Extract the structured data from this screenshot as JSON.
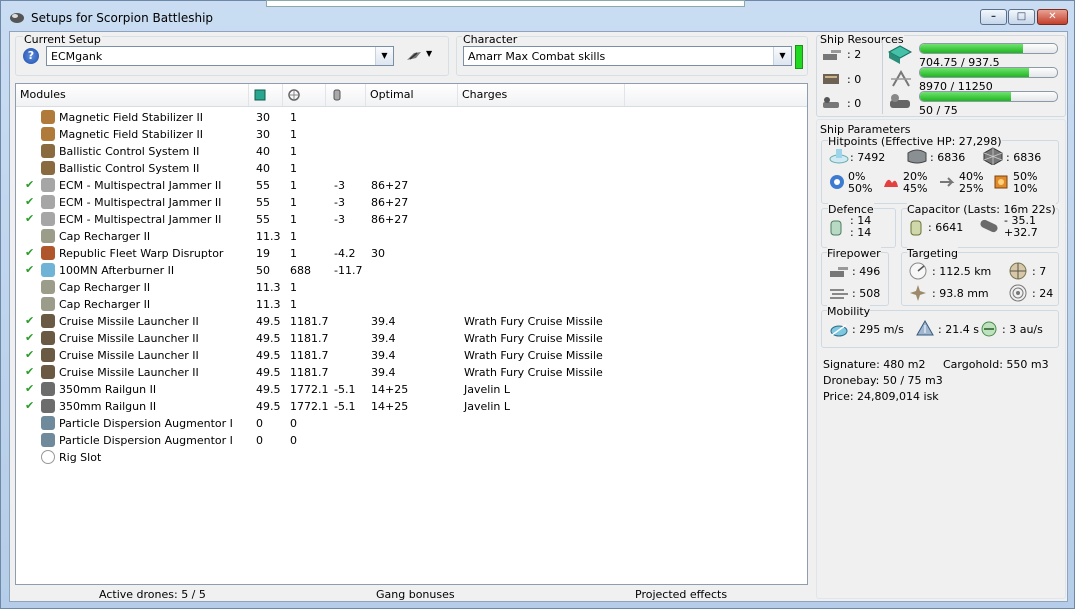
{
  "window": {
    "title": "Setups for Scorpion Battleship",
    "minimize_glyph": "–",
    "maximize_glyph": "□",
    "close_glyph": "✕"
  },
  "setup": {
    "label": "Current Setup",
    "value": "ECMgank"
  },
  "character": {
    "label": "Character",
    "value": "Amarr Max Combat skills"
  },
  "grid": {
    "columns": [
      "Modules",
      "",
      "",
      "",
      "Optimal",
      "Charges"
    ],
    "column_icons": [
      "cpu-icon",
      "power-grid-icon",
      "capacitor-use-icon"
    ],
    "rows": [
      {
        "checked": false,
        "icon": "magnetic-stabilizer-icon",
        "name": "Magnetic Field Stabilizer II",
        "cpu": "30",
        "pg": "1",
        "cap": "",
        "optimal": "",
        "charges": ""
      },
      {
        "checked": false,
        "icon": "magnetic-stabilizer-icon",
        "name": "Magnetic Field Stabilizer II",
        "cpu": "30",
        "pg": "1",
        "cap": "",
        "optimal": "",
        "charges": ""
      },
      {
        "checked": false,
        "icon": "ballistic-control-icon",
        "name": "Ballistic Control System II",
        "cpu": "40",
        "pg": "1",
        "cap": "",
        "optimal": "",
        "charges": ""
      },
      {
        "checked": false,
        "icon": "ballistic-control-icon",
        "name": "Ballistic Control System II",
        "cpu": "40",
        "pg": "1",
        "cap": "",
        "optimal": "",
        "charges": ""
      },
      {
        "checked": true,
        "icon": "ecm-jammer-icon",
        "name": "ECM - Multispectral Jammer II",
        "cpu": "55",
        "pg": "1",
        "cap": "-3",
        "optimal": "86+27",
        "charges": ""
      },
      {
        "checked": true,
        "icon": "ecm-jammer-icon",
        "name": "ECM - Multispectral Jammer II",
        "cpu": "55",
        "pg": "1",
        "cap": "-3",
        "optimal": "86+27",
        "charges": ""
      },
      {
        "checked": true,
        "icon": "ecm-jammer-icon",
        "name": "ECM - Multispectral Jammer II",
        "cpu": "55",
        "pg": "1",
        "cap": "-3",
        "optimal": "86+27",
        "charges": ""
      },
      {
        "checked": false,
        "icon": "cap-recharger-icon",
        "name": "Cap Recharger II",
        "cpu": "11.3",
        "pg": "1",
        "cap": "",
        "optimal": "",
        "charges": ""
      },
      {
        "checked": true,
        "icon": "warp-disruptor-icon",
        "name": "Republic Fleet Warp Disruptor",
        "cpu": "19",
        "pg": "1",
        "cap": "-4.2",
        "optimal": "30",
        "charges": ""
      },
      {
        "checked": true,
        "icon": "afterburner-icon",
        "name": "100MN Afterburner II",
        "cpu": "50",
        "pg": "688",
        "cap": "-11.7",
        "optimal": "",
        "charges": ""
      },
      {
        "checked": false,
        "icon": "cap-recharger-icon",
        "name": "Cap Recharger II",
        "cpu": "11.3",
        "pg": "1",
        "cap": "",
        "optimal": "",
        "charges": ""
      },
      {
        "checked": false,
        "icon": "cap-recharger-icon",
        "name": "Cap Recharger II",
        "cpu": "11.3",
        "pg": "1",
        "cap": "",
        "optimal": "",
        "charges": ""
      },
      {
        "checked": true,
        "icon": "missile-launcher-icon",
        "name": "Cruise Missile Launcher II",
        "cpu": "49.5",
        "pg": "1181.7",
        "cap": "",
        "optimal": "39.4",
        "charges": "Wrath Fury Cruise Missile"
      },
      {
        "checked": true,
        "icon": "missile-launcher-icon",
        "name": "Cruise Missile Launcher II",
        "cpu": "49.5",
        "pg": "1181.7",
        "cap": "",
        "optimal": "39.4",
        "charges": "Wrath Fury Cruise Missile"
      },
      {
        "checked": true,
        "icon": "missile-launcher-icon",
        "name": "Cruise Missile Launcher II",
        "cpu": "49.5",
        "pg": "1181.7",
        "cap": "",
        "optimal": "39.4",
        "charges": "Wrath Fury Cruise Missile"
      },
      {
        "checked": true,
        "icon": "missile-launcher-icon",
        "name": "Cruise Missile Launcher II",
        "cpu": "49.5",
        "pg": "1181.7",
        "cap": "",
        "optimal": "39.4",
        "charges": "Wrath Fury Cruise Missile"
      },
      {
        "checked": true,
        "icon": "railgun-icon",
        "name": "350mm Railgun II",
        "cpu": "49.5",
        "pg": "1772.1",
        "cap": "-5.1",
        "optimal": "14+25",
        "charges": "Javelin L"
      },
      {
        "checked": true,
        "icon": "railgun-icon",
        "name": "350mm Railgun II",
        "cpu": "49.5",
        "pg": "1772.1",
        "cap": "-5.1",
        "optimal": "14+25",
        "charges": "Javelin L"
      },
      {
        "checked": false,
        "icon": "rig-augmentor-icon",
        "name": "Particle Dispersion Augmentor I",
        "cpu": "0",
        "pg": "0",
        "cap": "",
        "optimal": "",
        "charges": ""
      },
      {
        "checked": false,
        "icon": "rig-augmentor-icon",
        "name": "Particle Dispersion Augmentor I",
        "cpu": "0",
        "pg": "0",
        "cap": "",
        "optimal": "",
        "charges": ""
      },
      {
        "checked": false,
        "icon": "rig-slot-icon",
        "name": "Rig Slot",
        "cpu": "",
        "pg": "",
        "cap": "",
        "optimal": "",
        "charges": ""
      }
    ]
  },
  "status_bar": {
    "drones": "Active drones: 5 / 5",
    "gang": "Gang bonuses",
    "projected": "Projected effects"
  },
  "resources": {
    "label": "Ship Resources",
    "turret_hardpoints": ": 2",
    "launcher_hardpoints": ": 0",
    "calibration": ": 0",
    "cpu_text": "704.75 / 937.5",
    "cpu_fraction": 0.752,
    "pg_text": "8970 / 11250",
    "pg_fraction": 0.797,
    "calibration_text": "50 / 75",
    "calibration_fraction": 0.667
  },
  "params": {
    "label": "Ship Parameters",
    "hitpoints_label": "Hitpoints (Effective HP: 27,298)",
    "shield_hp": ": 7492",
    "armor_hp": ": 6836",
    "structure_hp": ": 6836",
    "shield_em": "0%",
    "armor_em": "50%",
    "shield_thermal": "20%",
    "armor_thermal": "45%",
    "shield_kinetic": "40%",
    "armor_kinetic": "25%",
    "shield_explosive": "50%",
    "armor_explosive": "10%",
    "defence_label": "Defence",
    "defence_1": ": 14",
    "defence_2": ": 14",
    "capacitor_label": "Capacitor (Lasts: 16m 22s)",
    "capacitor_amount": ": 6641",
    "capacitor_delta_1": "- 35.1",
    "capacitor_delta_2": "+32.7",
    "firepower_label": "Firepower",
    "firepower_1": ": 496",
    "firepower_2": ": 508",
    "targeting_label": "Targeting",
    "target_range": ": 112.5 km",
    "max_targets": ": 7",
    "scan_res": ": 93.8 mm",
    "sensor_strength": ": 24",
    "mobility_label": "Mobility",
    "speed": ": 295 m/s",
    "align_time": ": 21.4 s",
    "warp_speed": ": 3 au/s",
    "signature": "Signature: 480 m2",
    "cargohold": "Cargohold: 550 m3",
    "dronebay": "Dronebay: 50 / 75 m3",
    "price": "Price: 24,809,014 isk"
  }
}
